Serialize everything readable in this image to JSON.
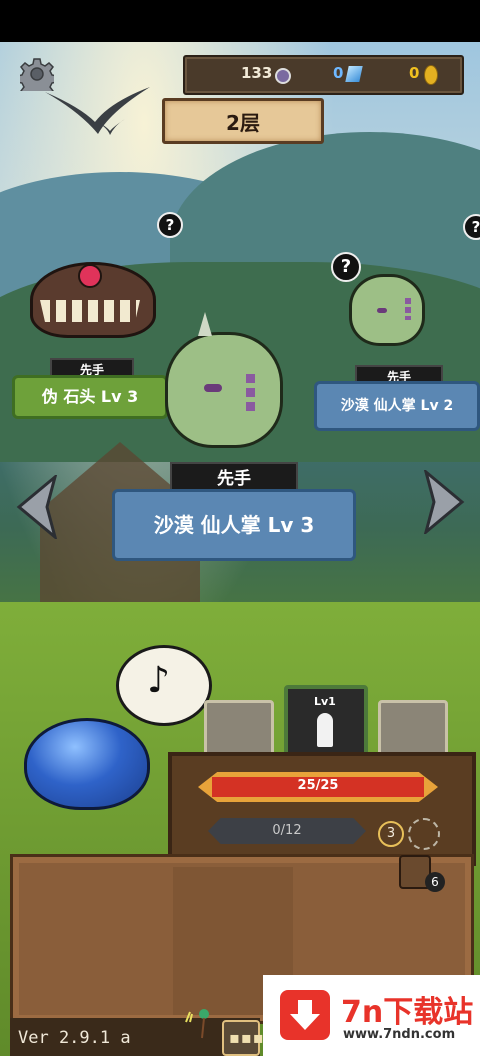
{
  "resources": {
    "gems": "133",
    "crystals": "0",
    "coins": "0"
  },
  "floor": {
    "label": "2层"
  },
  "enemies": [
    {
      "tag": "先手",
      "name": "伪 石头 Lv 3"
    },
    {
      "tag": "先手",
      "name": "沙漠 仙人掌 Lv 2"
    },
    {
      "tag": "先手",
      "name": "沙漠 仙人掌 Lv 3"
    }
  ],
  "unknown_mark": "?",
  "player": {
    "level_label": "Lv1",
    "hp": "25/25",
    "hp_fraction": 1.0,
    "exp": "0/12",
    "exp_fraction": 0.0,
    "skill_count": "3",
    "item_count": "6"
  },
  "version": "Ver 2.9.1 a",
  "watermark": {
    "title": "7n下载站",
    "url": "www.7ndn.com"
  },
  "colors": {
    "hp_red": "#d43224",
    "gold_frame": "#e8a33a",
    "slime_blue": "#2f63c9",
    "cactus_green": "#9dbf86"
  }
}
